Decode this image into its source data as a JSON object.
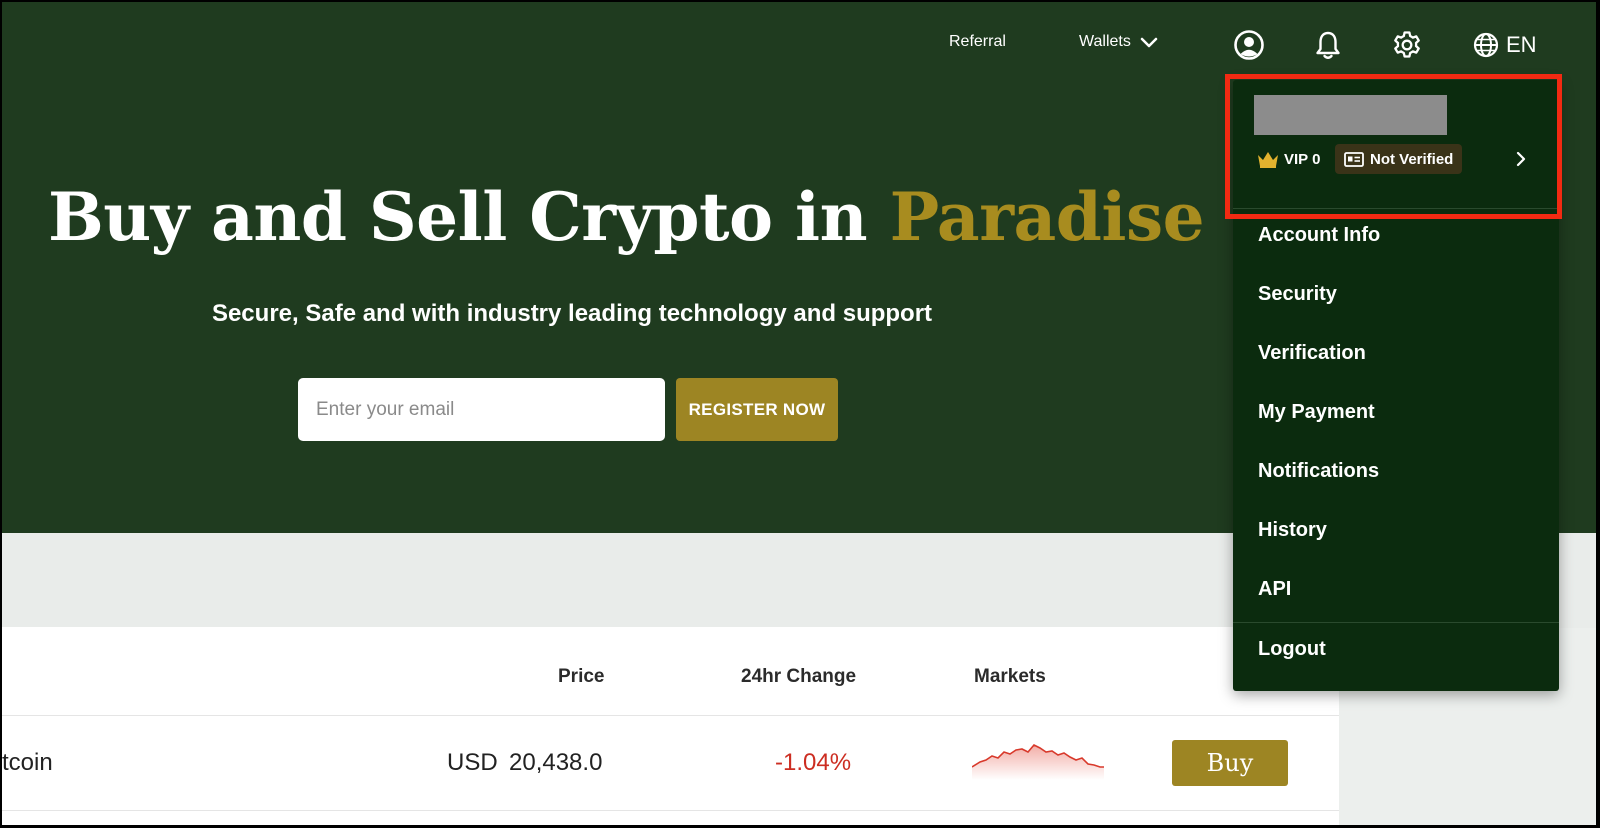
{
  "nav": {
    "referral": "Referral",
    "wallets": "Wallets",
    "language": "EN"
  },
  "hero": {
    "title_main": "Buy and Sell Crypto in ",
    "title_accent": "Paradise",
    "subtitle": "Secure, Safe and with industry leading technology and support",
    "email_placeholder": "Enter your email",
    "register_label": "REGISTER NOW"
  },
  "table": {
    "headers": {
      "price": "Price",
      "change": "24hr Change",
      "markets": "Markets"
    },
    "rows": [
      {
        "name": "tcoin",
        "currency": "USD",
        "price": "20,438.0",
        "change": "-1.04%",
        "action": "Buy"
      }
    ]
  },
  "account_menu": {
    "vip": "VIP 0",
    "verification_status": "Not Verified",
    "items": [
      "Account Info",
      "Security",
      "Verification",
      "My Payment",
      "Notifications",
      "History",
      "API"
    ],
    "logout": "Logout"
  },
  "colors": {
    "hero_bg": "#1f3b1f",
    "accent_gold": "#9d8523",
    "dropdown_bg": "#0b2b0e",
    "highlight_red": "#f22a12",
    "negative_red": "#cc2d21"
  },
  "icons": {
    "wallets_chevron": "chevron-down-icon",
    "profile": "user-circle-icon",
    "notifications": "bell-icon",
    "settings": "gear-icon",
    "language": "globe-icon",
    "vip": "crown-icon",
    "verification": "id-card-icon",
    "menu_expand": "chevron-right-icon"
  }
}
